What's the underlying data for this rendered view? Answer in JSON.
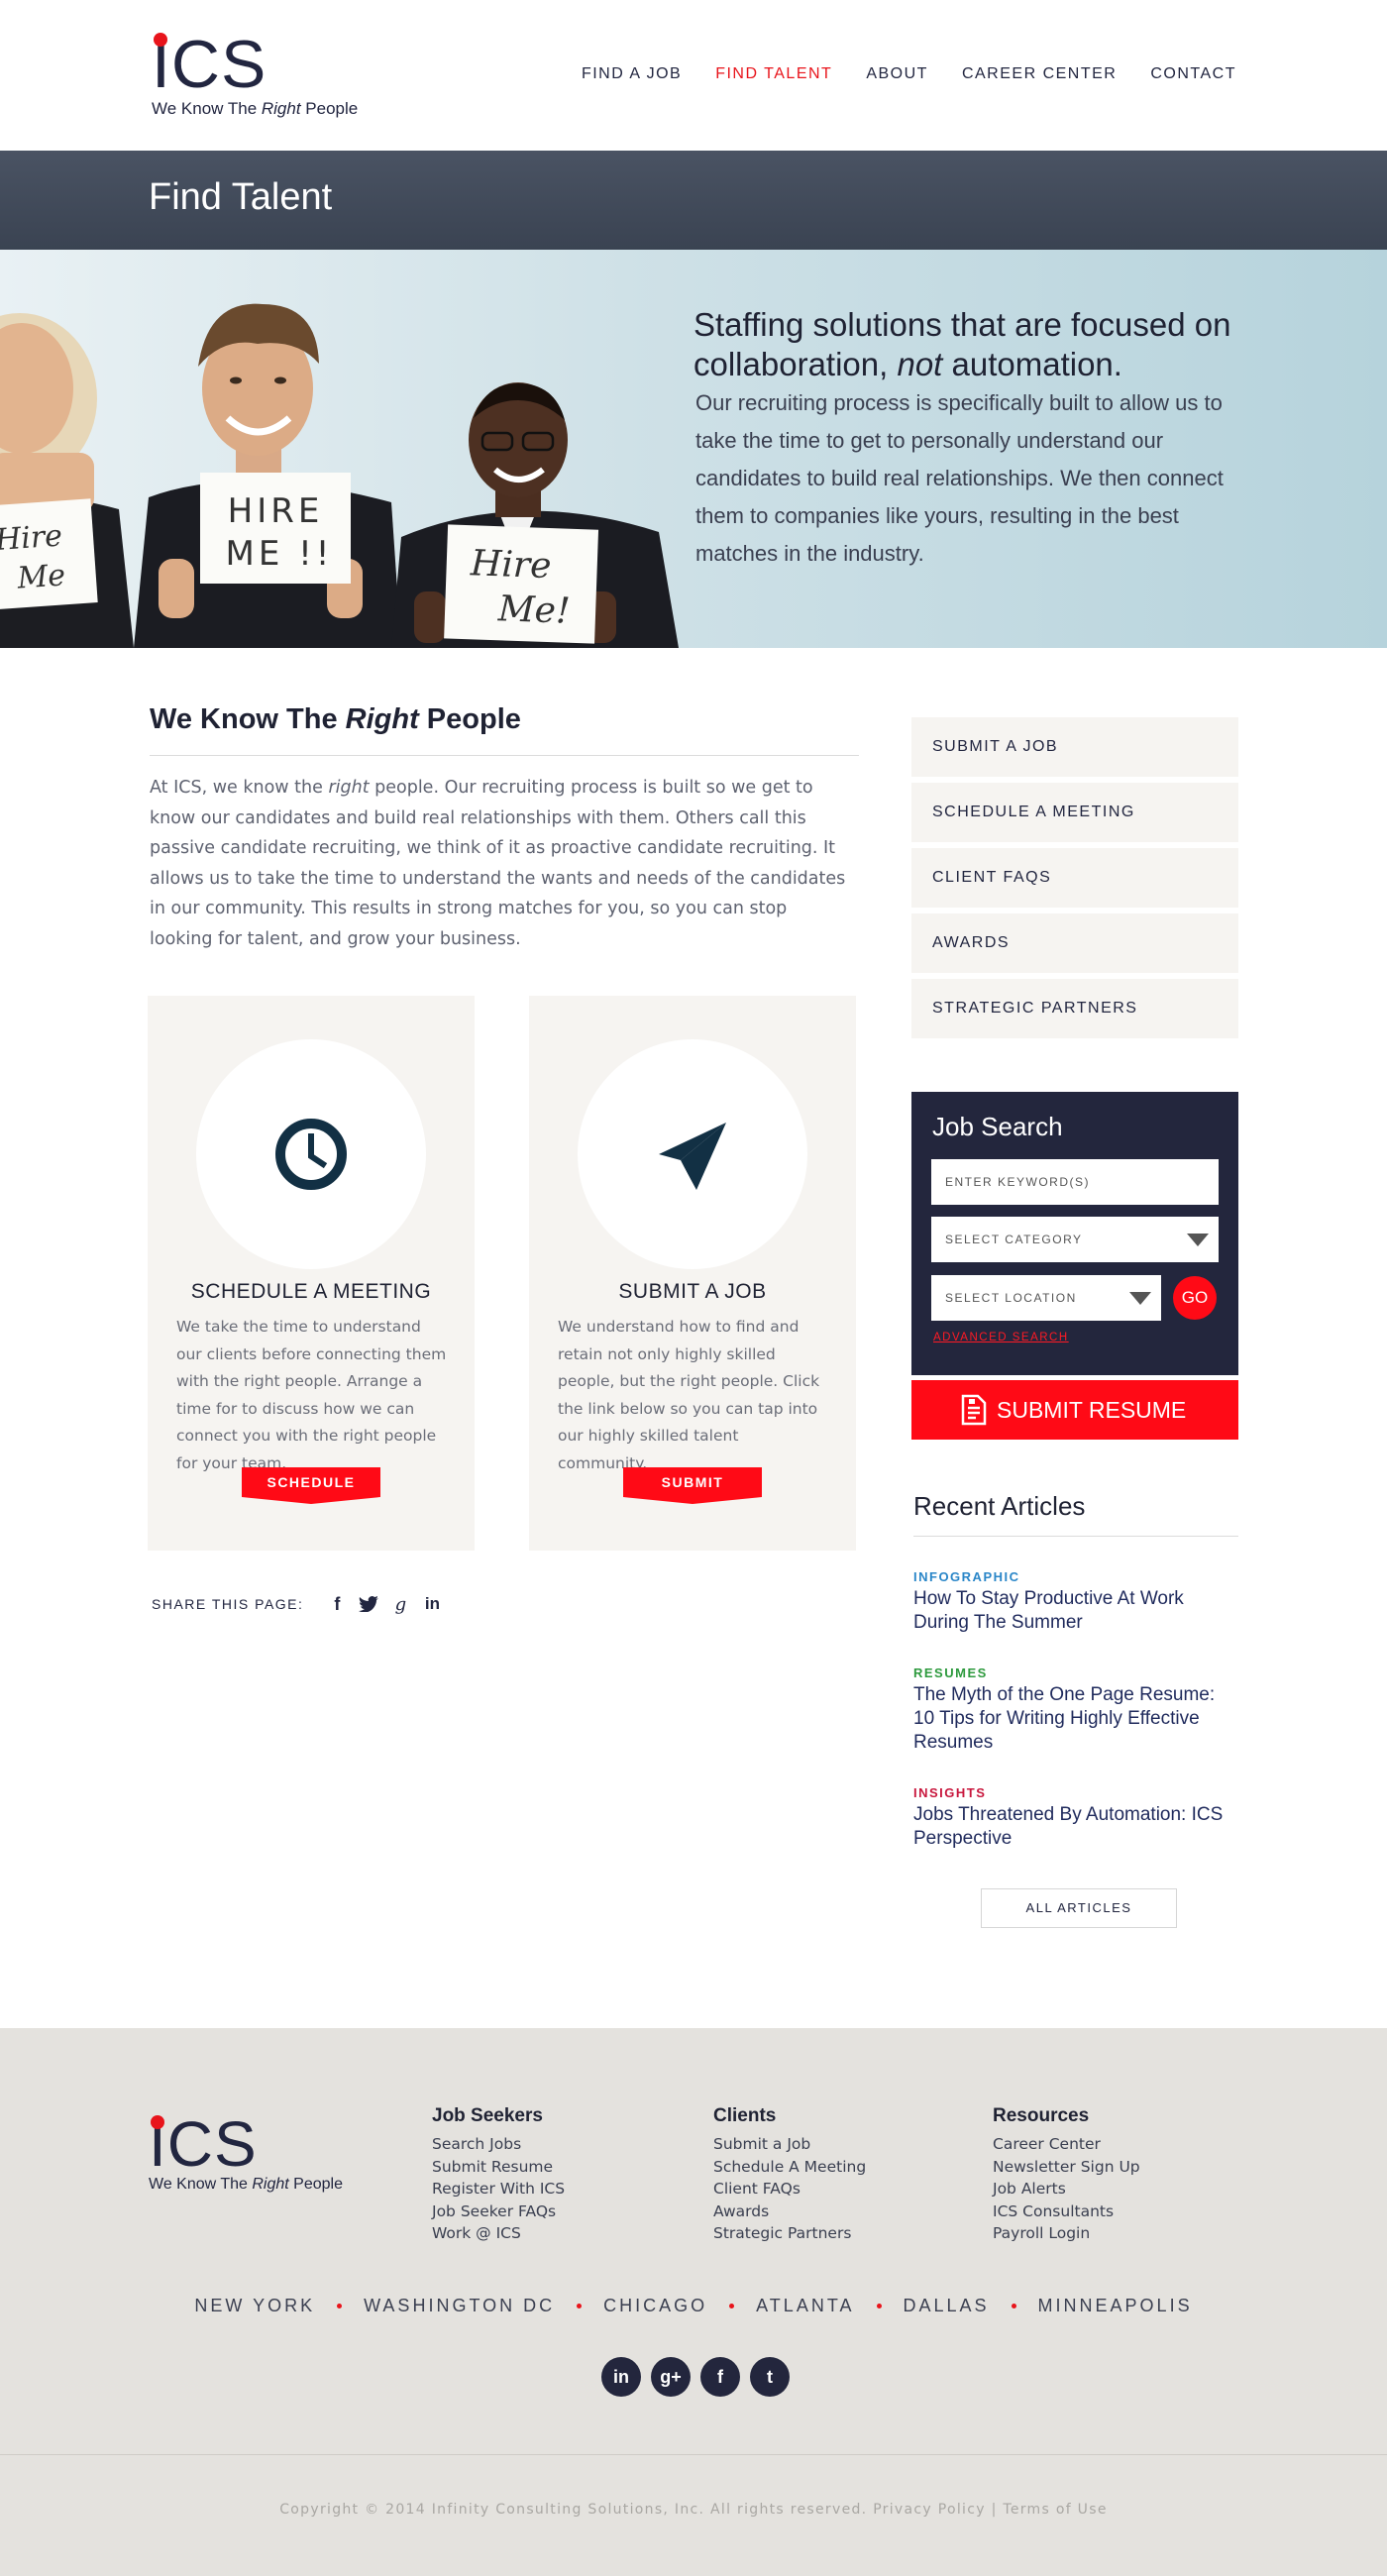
{
  "brand": {
    "logo_text": "ICS",
    "tagline_before": "We Know The ",
    "tagline_em": "Right",
    "tagline_after": " People",
    "accent": "#e8141b",
    "navy": "#222640"
  },
  "nav": {
    "items": [
      {
        "label": "FIND A JOB"
      },
      {
        "label": "FIND TALENT",
        "active": true
      },
      {
        "label": "ABOUT"
      },
      {
        "label": "CAREER CENTER"
      },
      {
        "label": "CONTACT"
      }
    ]
  },
  "page_title": "Find Talent",
  "hero": {
    "heading_line1": "Staffing solutions that are focused on",
    "heading_pre": "collaboration, ",
    "heading_em": "not",
    "heading_post": " automation.",
    "body": "Our recruiting process is specifically built to allow us to take the time to get to personally understand our candidates to build real relationships. We then connect them to companies like yours, resulting in the best matches in the industry.",
    "sign_1": "Hire Me",
    "sign_2": "HIRE ME !!",
    "sign_3": "Hire Me!"
  },
  "main": {
    "title_before": "We Know The ",
    "title_em": "Right",
    "title_after": " People",
    "intro_before": "At ICS, we know the ",
    "intro_em": "right",
    "intro_after": " people. Our recruiting process is built so we get to know our candidates and build real relationships with them. Others call this passive candidate recruiting, we think of it as proactive candidate recruiting. It allows us to take the time to understand the wants and needs of the candidates in our community. This results in strong matches for you, so you can stop looking for talent, and grow your business.",
    "cards": [
      {
        "icon": "clock-icon",
        "title": "SCHEDULE A MEETING",
        "text": "We take the time to understand our clients before connecting them with the right people. Arrange a time for to discuss how we can connect you with the right people for your team.",
        "button": "SCHEDULE"
      },
      {
        "icon": "paper-plane-icon",
        "title": "SUBMIT A JOB",
        "text": "We understand how to find and retain not only highly skilled people, but the right people. Click the link below so you can tap into our highly skilled talent community.",
        "button": "SUBMIT"
      }
    ],
    "share_label": "SHARE THIS PAGE:",
    "share_icons": [
      "facebook-icon",
      "twitter-icon",
      "google-plus-icon",
      "linkedin-icon"
    ]
  },
  "sidebar": {
    "links": [
      {
        "label": "SUBMIT A JOB"
      },
      {
        "label": "SCHEDULE A MEETING"
      },
      {
        "label": "CLIENT FAQs"
      },
      {
        "label": "AWARDS"
      },
      {
        "label": "STRATEGIC PARTNERS"
      }
    ],
    "job_search": {
      "title": "Job Search",
      "keyword_placeholder": "ENTER KEYWORD(S)",
      "category_value": "SELECT CATEGORY",
      "location_value": "SELECT LOCATION",
      "go_label": "GO",
      "advanced_label": "ADVANCED SEARCH"
    },
    "submit_resume": "SUBMIT RESUME",
    "recent_title": "Recent Articles",
    "articles": [
      {
        "category": "INFOGRAPHIC",
        "color": "#2a86c8",
        "title": "How To Stay Productive At Work During The Summer"
      },
      {
        "category": "RESUMES",
        "color": "#2e9a3e",
        "title": "The Myth of the One Page Resume: 10 Tips for Writing Highly Effective Resumes"
      },
      {
        "category": "INSIGHTS",
        "color": "#c8173d",
        "title": "Jobs Threatened By Automation: ICS Perspective"
      }
    ],
    "all_articles": "ALL ARTICLES"
  },
  "footer": {
    "columns": [
      {
        "heading": "Job Seekers",
        "links": [
          "Search Jobs",
          "Submit Resume",
          "Register With ICS",
          "Job Seeker FAQs",
          "Work @ ICS"
        ]
      },
      {
        "heading": "Clients",
        "links": [
          "Submit a Job",
          "Schedule A Meeting",
          "Client FAQs",
          "Awards",
          "Strategic Partners"
        ]
      },
      {
        "heading": "Resources",
        "links": [
          "Career Center",
          "Newsletter Sign Up",
          "Job Alerts",
          "ICS Consultants",
          "Payroll Login"
        ]
      }
    ],
    "cities": [
      "NEW YORK",
      "WASHINGTON DC",
      "CHICAGO",
      "ATLANTA",
      "DALLAS",
      "MINNEAPOLIS"
    ],
    "social": [
      {
        "icon": "linkedin-icon",
        "glyph": "in"
      },
      {
        "icon": "google-plus-icon",
        "glyph": "g+"
      },
      {
        "icon": "facebook-icon",
        "glyph": "f"
      },
      {
        "icon": "twitter-icon",
        "glyph": "t"
      }
    ],
    "copyright": "Copyright © 2014 Infinity Consulting Solutions, Inc. All rights reserved.",
    "privacy": "Privacy Policy",
    "separator": "|",
    "terms": "Terms of Use"
  }
}
